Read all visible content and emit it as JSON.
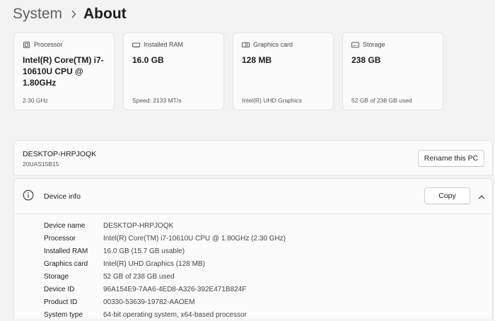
{
  "breadcrumb": {
    "parent": "System",
    "current": "About"
  },
  "tiles": [
    {
      "icon": "processor-icon",
      "label": "Processor",
      "value": "Intel(R) Core(TM) i7-10610U CPU @ 1.80GHz",
      "sub": "2.30 GHz"
    },
    {
      "icon": "ram-icon",
      "label": "Installed RAM",
      "value": "16.0 GB",
      "sub": "Speed: 2133 MT/s"
    },
    {
      "icon": "graphics-card-icon",
      "label": "Graphics card",
      "value": "128 MB",
      "sub": "Intel(R) UHD Graphics"
    },
    {
      "icon": "storage-icon",
      "label": "Storage",
      "value": "238 GB",
      "sub": "52 GB of 238 GB used"
    }
  ],
  "pc": {
    "name": "DESKTOP-HRPJOQK",
    "model": "20UAS15B15",
    "rename_label": "Rename this PC"
  },
  "device_info": {
    "title": "Device info",
    "copy_label": "Copy",
    "specs": [
      {
        "label": "Device name",
        "value": "DESKTOP-HRPJOQK"
      },
      {
        "label": "Processor",
        "value": "Intel(R) Core(TM) i7-10610U CPU @ 1.80GHz (2.30 GHz)"
      },
      {
        "label": "Installed RAM",
        "value": "16.0 GB (15.7 GB usable)"
      },
      {
        "label": "Graphics card",
        "value": "Intel(R) UHD Graphics (128 MB)"
      },
      {
        "label": "Storage",
        "value": "52 GB of 238 GB used"
      },
      {
        "label": "Device ID",
        "value": "96A154E9-7AA6-4ED8-A326-392E471B824F"
      },
      {
        "label": "Product ID",
        "value": "00330-53639-19782-AAOEM"
      },
      {
        "label": "System type",
        "value": "64-bit operating system, x64-based processor"
      }
    ]
  },
  "colors": {
    "background": "#f3f3f3",
    "card": "#fbfbfb",
    "border": "#e3e3e3",
    "text": "#1b1b1b"
  }
}
